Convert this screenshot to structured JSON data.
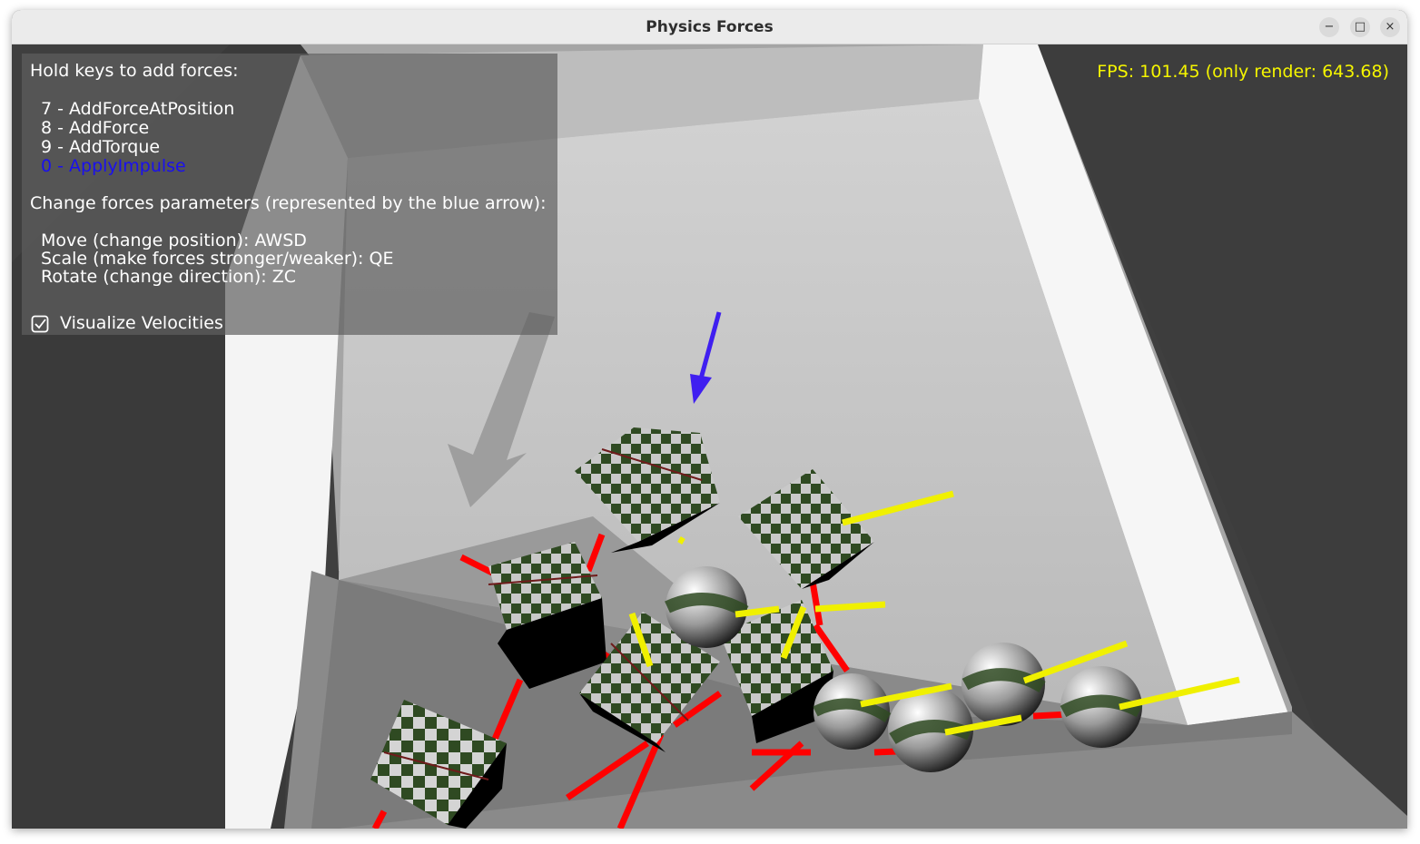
{
  "window": {
    "title": "Physics Forces",
    "controls": {
      "minimize": "−",
      "maximize": "□",
      "close": "×"
    }
  },
  "overlay": {
    "heading": "Hold keys to add forces:",
    "force_items": [
      {
        "label": "7 - AddForceAtPosition",
        "active": false
      },
      {
        "label": "8 - AddForce",
        "active": false
      },
      {
        "label": "9 - AddTorque",
        "active": false
      },
      {
        "label": "0 - ApplyImpulse",
        "active": true
      }
    ],
    "params_heading": "Change forces parameters (represented by the blue arrow):",
    "param_items": [
      "Move (change position): AWSD",
      "Scale (make forces stronger/weaker): QE",
      "Rotate (change direction): ZC"
    ],
    "checkbox": {
      "label": "Visualize Velocities",
      "checked": true
    }
  },
  "fps": "FPS: 101.45 (only render: 643.68)",
  "colors": {
    "active_item": "#1a10ee",
    "fps_text": "#f5f500",
    "force_arrow": "#3f1ff0",
    "velocity_line": "#f0f000",
    "angular_line": "#ff0000",
    "checker_dark": "#2f4a22",
    "checker_light": "#c9c9c9"
  }
}
